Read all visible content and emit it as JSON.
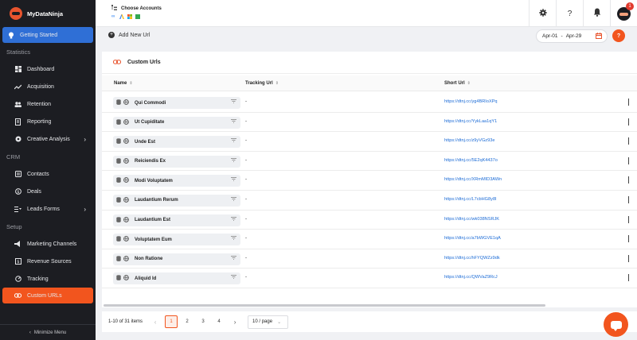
{
  "brand": {
    "name": "MyDataNinja"
  },
  "sidebar": {
    "getting_started": "Getting Started",
    "sections": [
      {
        "label": "Statistics"
      },
      {
        "label": "CRM"
      },
      {
        "label": "Setup"
      }
    ],
    "statistics_items": [
      {
        "label": "Dashboard",
        "icon": "dashboard-icon"
      },
      {
        "label": "Acquisition",
        "icon": "trend-icon"
      },
      {
        "label": "Retention",
        "icon": "users-icon"
      },
      {
        "label": "Reporting",
        "icon": "report-icon"
      },
      {
        "label": "Creative Analysis",
        "icon": "creative-icon"
      }
    ],
    "crm_items": [
      {
        "label": "Contacts",
        "icon": "contacts-icon"
      },
      {
        "label": "Deals",
        "icon": "deals-icon"
      },
      {
        "label": "Leads Forms",
        "icon": "forms-icon"
      }
    ],
    "setup_items": [
      {
        "label": "Marketing Channels",
        "icon": "megaphone-icon"
      },
      {
        "label": "Revenue Sources",
        "icon": "revenue-icon"
      },
      {
        "label": "Tracking",
        "icon": "tracking-icon"
      },
      {
        "label": "Custom URLs",
        "icon": "link-icon"
      }
    ],
    "minimize": "Minimize Menu"
  },
  "topbar": {
    "choose_accounts": "Choose Accounts",
    "notifications_badge": "1"
  },
  "actions": {
    "add_new_url": "Add New Url",
    "date_from": "Apr-01",
    "date_sep": "-",
    "date_to": "Apr-29",
    "help": "?"
  },
  "card": {
    "title": "Custom Urls",
    "columns": {
      "name": "Name",
      "tracking": "Tracking Url",
      "short": "Short Url"
    }
  },
  "rows": [
    {
      "name": "Qui Commodi",
      "tracking": "-",
      "short": "https://dtnj.cc/yg4BRIoXPq"
    },
    {
      "name": "Ut Cupiditate",
      "tracking": "-",
      "short": "https://dtnj.cc/YykLaa1qY1"
    },
    {
      "name": "Unde Est",
      "tracking": "-",
      "short": "https://dtnj.cc/z9yVGz93e"
    },
    {
      "name": "Reiciendis Ex",
      "tracking": "-",
      "short": "https://dtnj.cc/5E2qK4437o"
    },
    {
      "name": "Modi Voluptatem",
      "tracking": "-",
      "short": "https://dtnj.cc/XRmMID3AWn"
    },
    {
      "name": "Laudantium Rerum",
      "tracking": "-",
      "short": "https://dtnj.cc/L7cbHG8y8I"
    },
    {
      "name": "Laudantium Est",
      "tracking": "-",
      "short": "https://dtnj.cc/wk038NSRJK"
    },
    {
      "name": "Voluptatem Eum",
      "tracking": "-",
      "short": "https://dtnj.cc/a7bWGVE1qA"
    },
    {
      "name": "Non Ratione",
      "tracking": "-",
      "short": "https://dtnj.cc/hFYQWZz9dk"
    },
    {
      "name": "Aliquid Id",
      "tracking": "-",
      "short": "https://dtnj.cc/QWVaZ9RcJ"
    }
  ],
  "pagination": {
    "info": "1-10 of 31 items",
    "pages": [
      "1",
      "2",
      "3",
      "4"
    ],
    "current": "1",
    "page_size": "10 / page"
  },
  "colors": {
    "accent": "#f2551e",
    "primary": "#2f6fd6",
    "sidebar": "#1c1d22",
    "link": "#1b6bd6"
  }
}
